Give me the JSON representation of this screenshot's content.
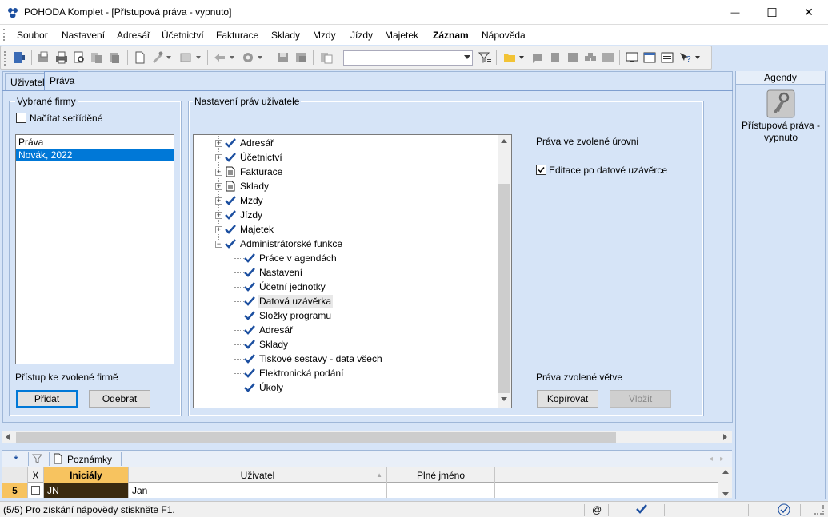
{
  "window": {
    "title": "POHODA Komplet - [Přístupová práva - vypnuto]",
    "minimize": "—",
    "maximize": "☐",
    "close": "✕"
  },
  "menu": {
    "items": [
      "Soubor",
      "Nastavení",
      "Adresář",
      "Účetnictví",
      "Fakturace",
      "Sklady",
      "Mzdy",
      "Jízdy",
      "Majetek",
      "Záznam",
      "Nápověda"
    ]
  },
  "toolbar": {
    "combo_value": ""
  },
  "tabs": {
    "uzivatel": "Uživatel",
    "prava": "Práva"
  },
  "firms": {
    "group_title": "Vybrané firmy",
    "sorted_checkbox": "Načítat setříděné",
    "list_header": "Práva",
    "list_items": [
      "Novák, 2022"
    ],
    "access_label": "Přístup ke zvolené firmě",
    "add_button": "Přidat",
    "remove_button": "Odebrat"
  },
  "rights": {
    "group_title": "Nastavení práv uživatele",
    "tree": [
      {
        "label": "Adresář",
        "icon": "check-icon",
        "expander": "+"
      },
      {
        "label": "Účetnictví",
        "icon": "check-icon",
        "expander": "+"
      },
      {
        "label": "Fakturace",
        "icon": "document-icon",
        "expander": "+"
      },
      {
        "label": "Sklady",
        "icon": "document-icon",
        "expander": "+"
      },
      {
        "label": "Mzdy",
        "icon": "check-icon",
        "expander": "+"
      },
      {
        "label": "Jízdy",
        "icon": "check-icon",
        "expander": "+"
      },
      {
        "label": "Majetek",
        "icon": "check-icon",
        "expander": "+"
      },
      {
        "label": "Administrátorské funkce",
        "icon": "check-icon",
        "expander": "−"
      }
    ],
    "children": [
      "Práce v agendách",
      "Nastavení",
      "Účetní jednotky",
      "Datová uzávěrka",
      "Složky programu",
      "Adresář",
      "Sklady",
      "Tiskové sestavy - data všech",
      "Elektronická podání",
      "Úkoly"
    ],
    "selected_child": "Datová uzávěrka",
    "level_title": "Práva ve zvolené úrovni",
    "edit_after_close": "Editace po datové uzávěrce",
    "branch_title": "Práva zvolené větve",
    "copy_button": "Kopírovat",
    "paste_button": "Vložit"
  },
  "agendy": {
    "header": "Agendy",
    "item_label": "Přístupová práva - vypnuto"
  },
  "bottom": {
    "star_tab": "*",
    "notes_tab": "Poznámky",
    "columns": [
      "X",
      "Iniciály",
      "Uživatel",
      "Plné jméno"
    ],
    "row": {
      "num": "5",
      "initials": "JN",
      "user": "Jan",
      "fullname": ""
    }
  },
  "status": {
    "text": "(5/5) Pro získání nápovědy stiskněte F1.",
    "at": "@"
  }
}
